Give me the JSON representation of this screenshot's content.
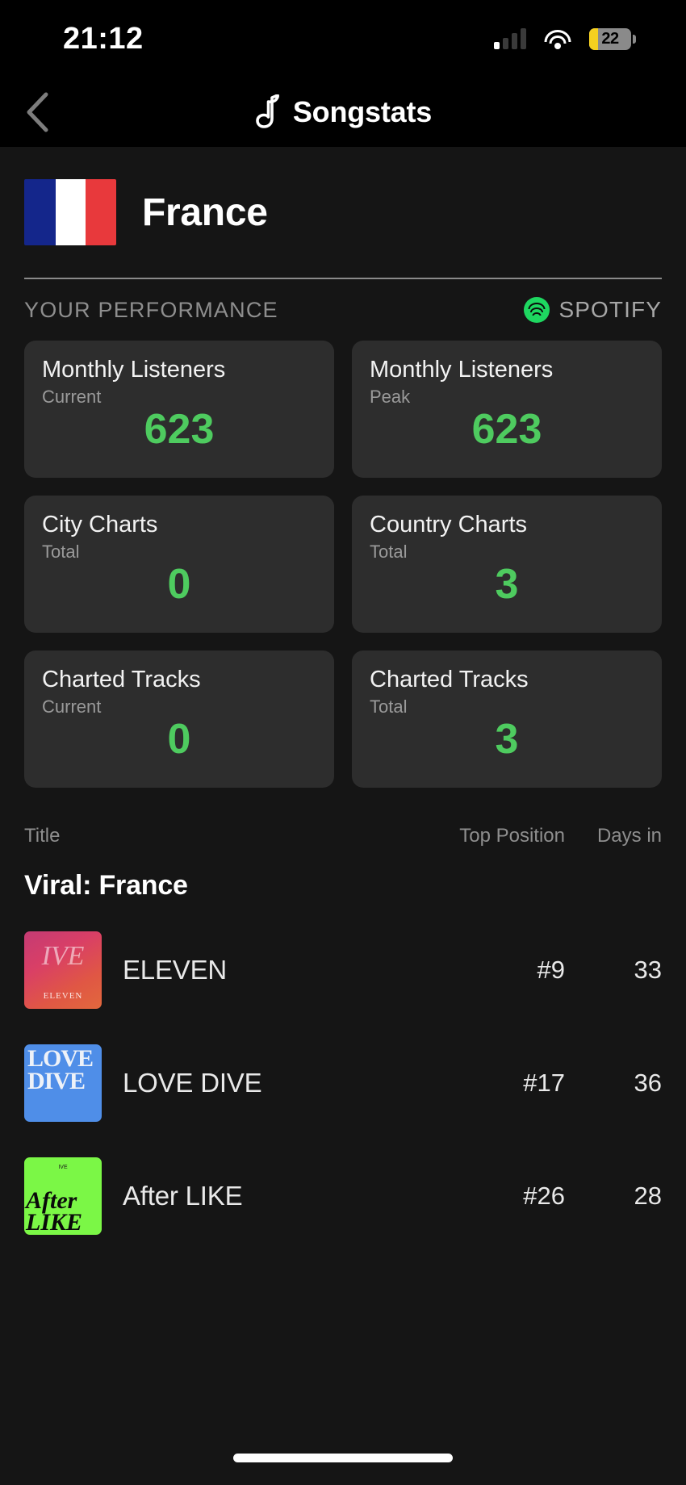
{
  "status_bar": {
    "time": "21:12",
    "battery_percent": "22",
    "battery_level": 22,
    "signal_icon": "cellular-signal-icon",
    "wifi_icon": "wifi-icon",
    "battery_icon": "battery-icon",
    "low_power_color": "#f5d020"
  },
  "nav": {
    "back_icon": "chevron-left-icon",
    "app_logo_icon": "songstats-logo-icon",
    "app_name": "Songstats"
  },
  "country": {
    "name": "France",
    "flag_icon": "france-flag-icon",
    "flag_colors": [
      "#14268b",
      "#ffffff",
      "#e8393c"
    ]
  },
  "performance": {
    "section_label": "YOUR PERFORMANCE",
    "source_icon": "spotify-icon",
    "source_name": "SPOTIFY",
    "source_color": "#1ed760",
    "value_color": "#4ecb5f",
    "cards": [
      {
        "title": "Monthly Listeners",
        "subtitle": "Current",
        "value": "623"
      },
      {
        "title": "Monthly Listeners",
        "subtitle": "Peak",
        "value": "623"
      },
      {
        "title": "City Charts",
        "subtitle": "Total",
        "value": "0"
      },
      {
        "title": "Country Charts",
        "subtitle": "Total",
        "value": "3"
      },
      {
        "title": "Charted Tracks",
        "subtitle": "Current",
        "value": "0"
      },
      {
        "title": "Charted Tracks",
        "subtitle": "Total",
        "value": "3"
      }
    ]
  },
  "charts_table": {
    "columns": {
      "title": "Title",
      "top_position": "Top Position",
      "days_in": "Days in"
    },
    "section": "Viral: France",
    "rows": [
      {
        "title": "ELEVEN",
        "top_position": "#9",
        "days_in": "33",
        "art_label": "ELEVEN",
        "art_mark": "IVE"
      },
      {
        "title": "LOVE DIVE",
        "top_position": "#17",
        "days_in": "36",
        "art_label": "LOVE DIVE",
        "art_mark": "LOVE DIVE"
      },
      {
        "title": "After LIKE",
        "top_position": "#26",
        "days_in": "28",
        "art_label": "After LIKE",
        "art_mark": "After LIKE"
      }
    ]
  },
  "home_indicator": "home-indicator"
}
